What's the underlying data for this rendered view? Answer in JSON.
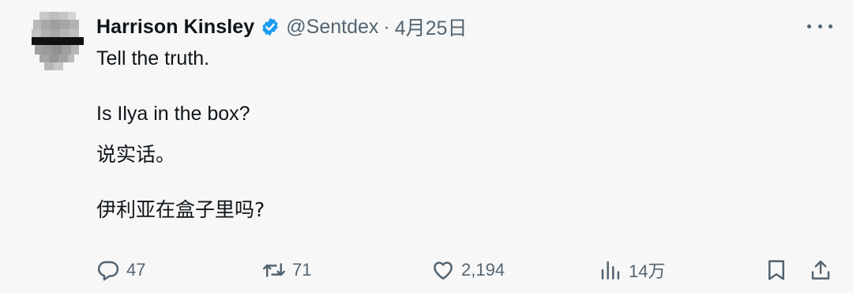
{
  "tweet": {
    "author_name": "Harrison Kinsley",
    "handle": "@Sentdex",
    "separator": "·",
    "date": "4月25日",
    "lines": [
      "Tell the truth.",
      "Is Ilya in the box?",
      "说实话。",
      "伊利亚在盒子里吗?"
    ]
  },
  "actions": {
    "replies": "47",
    "retweets": "71",
    "likes": "2,194",
    "views": "14万"
  },
  "icons": {
    "verified": "verified-badge-icon",
    "more": "more-dots-icon",
    "reply": "reply-icon",
    "retweet": "retweet-icon",
    "like": "heart-icon",
    "views": "views-bar-chart-icon",
    "bookmark": "bookmark-icon",
    "share": "share-icon"
  },
  "colors": {
    "background": "#f7f7f7",
    "text": "#0f1419",
    "secondary": "#536471",
    "verified": "#1d9bf0"
  }
}
